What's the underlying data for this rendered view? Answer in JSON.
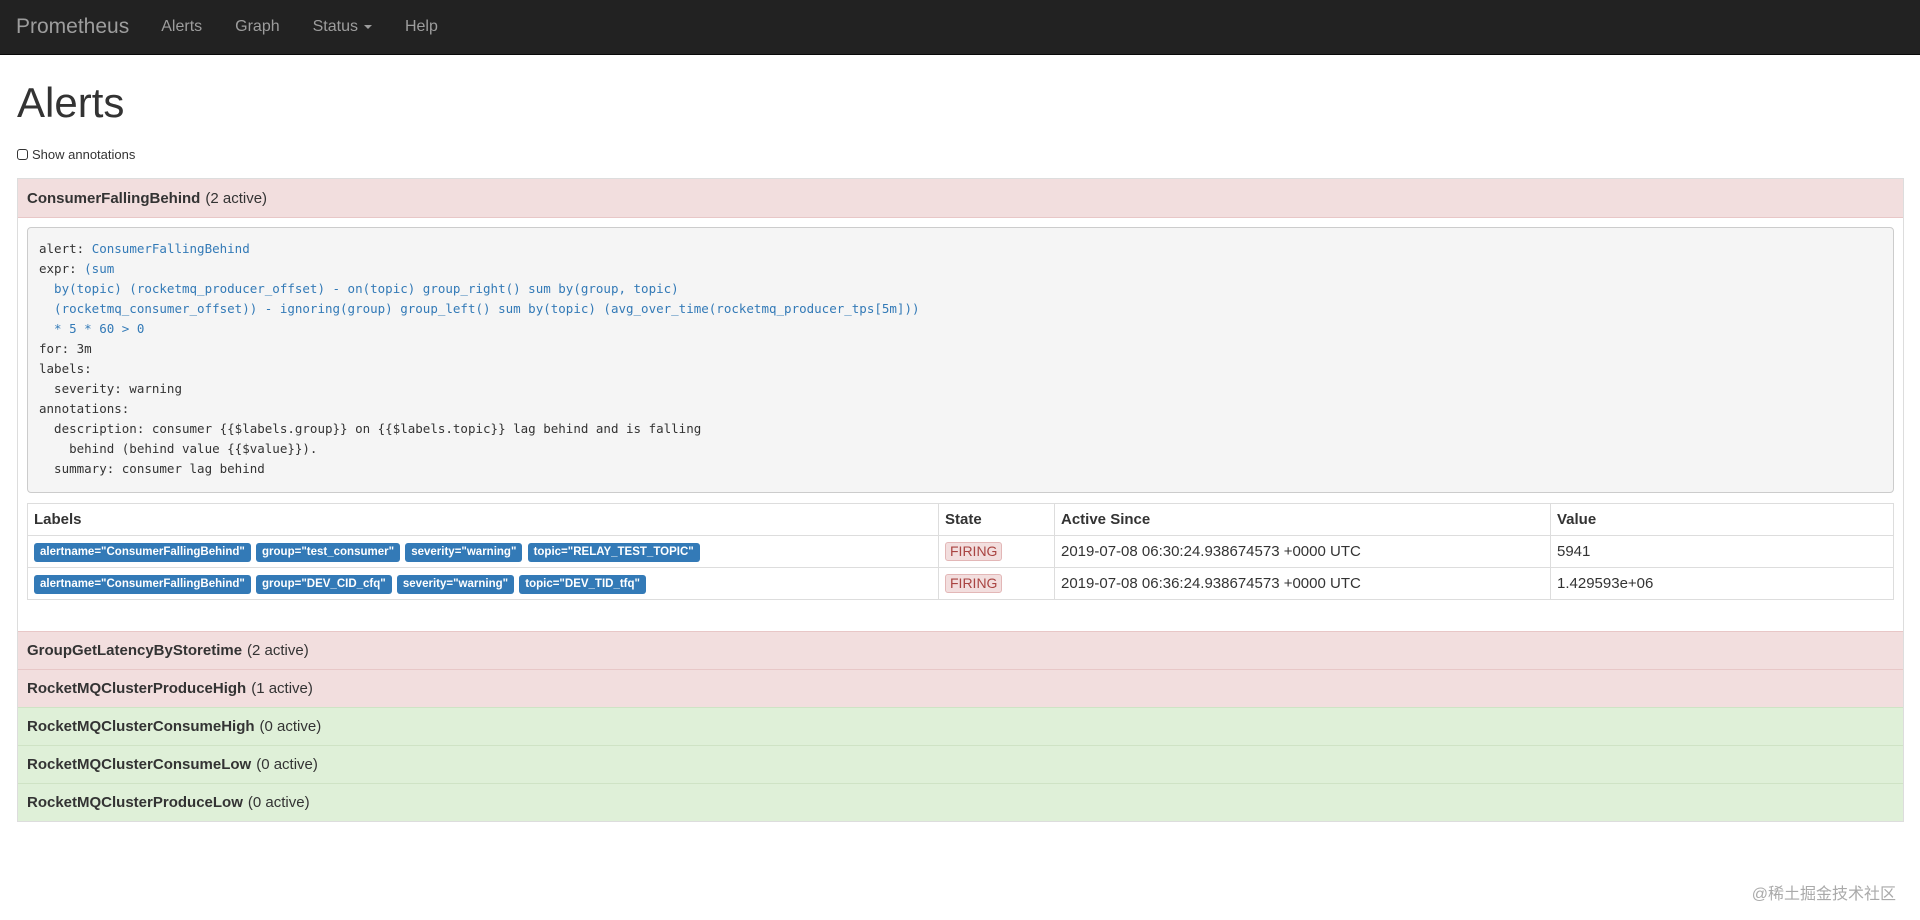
{
  "navbar": {
    "brand": "Prometheus",
    "links": [
      "Alerts",
      "Graph",
      "Status",
      "Help"
    ]
  },
  "page": {
    "title": "Alerts",
    "show_annotations_label": "Show annotations"
  },
  "alert_groups": [
    {
      "name": "ConsumerFallingBehind",
      "count": "(2 active)",
      "state": "firing"
    },
    {
      "name": "GroupGetLatencyByStoretime",
      "count": "(2 active)",
      "state": "firing"
    },
    {
      "name": "RocketMQClusterProduceHigh",
      "count": "(1 active)",
      "state": "firing"
    },
    {
      "name": "RocketMQClusterConsumeHigh",
      "count": "(0 active)",
      "state": "inactive"
    },
    {
      "name": "RocketMQClusterConsumeLow",
      "count": "(0 active)",
      "state": "inactive"
    },
    {
      "name": "RocketMQClusterProduceLow",
      "count": "(0 active)",
      "state": "inactive"
    }
  ],
  "rule": {
    "alert_key": "alert: ",
    "alert_value": "ConsumerFallingBehind",
    "expr_key": "expr: ",
    "expr_value": "(sum\n  by(topic) (rocketmq_producer_offset) - on(topic) group_right() sum by(group, topic)\n  (rocketmq_consumer_offset)) - ignoring(group) group_left() sum by(topic) (avg_over_time(rocketmq_producer_tps[5m]))\n  * 5 * 60 > 0",
    "rest": "\nfor: 3m\nlabels:\n  severity: warning\nannotations:\n  description: consumer {{$labels.group}} on {{$labels.topic}} lag behind and is falling\n    behind (behind value {{$value}}).\n  summary: consumer lag behind"
  },
  "table": {
    "headers": [
      "Labels",
      "State",
      "Active Since",
      "Value"
    ],
    "rows": [
      {
        "labels": [
          "alertname=\"ConsumerFallingBehind\"",
          "group=\"test_consumer\"",
          "severity=\"warning\"",
          "topic=\"RELAY_TEST_TOPIC\""
        ],
        "state": "FIRING",
        "active_since": "2019-07-08 06:30:24.938674573 +0000 UTC",
        "value": "5941"
      },
      {
        "labels": [
          "alertname=\"ConsumerFallingBehind\"",
          "group=\"DEV_CID_cfq\"",
          "severity=\"warning\"",
          "topic=\"DEV_TID_tfq\""
        ],
        "state": "FIRING",
        "active_since": "2019-07-08 06:36:24.938674573 +0000 UTC",
        "value": "1.429593e+06"
      }
    ]
  },
  "watermark": "@稀土掘金技术社区"
}
